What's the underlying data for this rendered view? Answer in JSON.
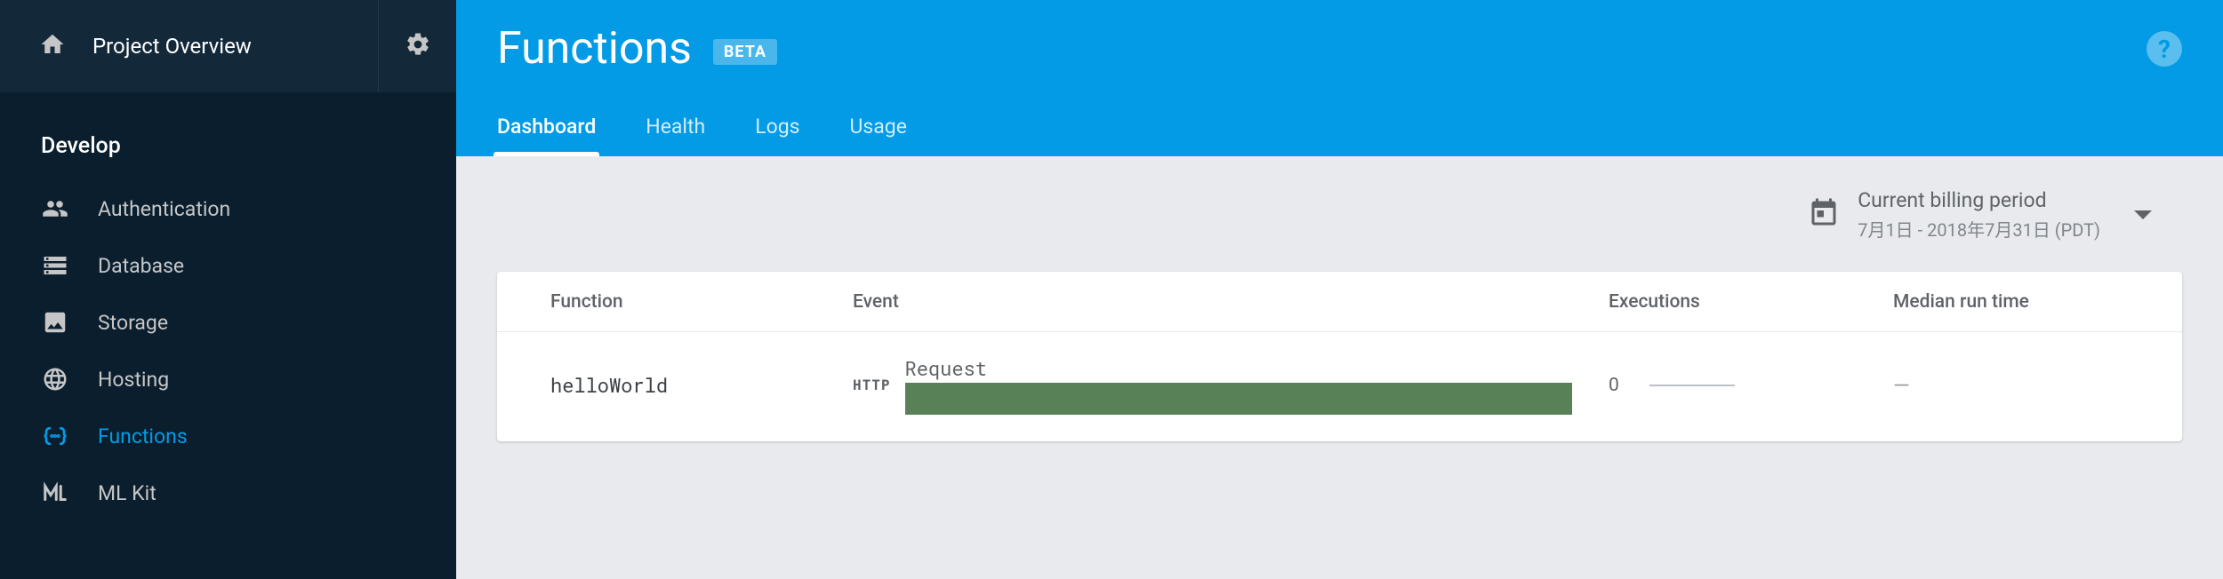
{
  "sidebar": {
    "overview_label": "Project Overview",
    "section_label": "Develop",
    "items": [
      {
        "label": "Authentication",
        "icon": "people"
      },
      {
        "label": "Database",
        "icon": "database"
      },
      {
        "label": "Storage",
        "icon": "storage"
      },
      {
        "label": "Hosting",
        "icon": "globe"
      },
      {
        "label": "Functions",
        "icon": "brackets",
        "active": true
      },
      {
        "label": "ML Kit",
        "icon": "ml"
      }
    ]
  },
  "header": {
    "title": "Functions",
    "badge": "BETA",
    "help_glyph": "?"
  },
  "tabs": [
    {
      "label": "Dashboard",
      "active": true
    },
    {
      "label": "Health"
    },
    {
      "label": "Logs"
    },
    {
      "label": "Usage"
    }
  ],
  "period": {
    "label": "Current billing period",
    "range": "7月1日 - 2018年7月31日 (PDT)"
  },
  "table": {
    "headers": {
      "function": "Function",
      "event": "Event",
      "executions": "Executions",
      "median": "Median run time"
    },
    "row": {
      "function_name": "helloWorld",
      "event_tag": "HTTP",
      "event_label": "Request",
      "executions": "0",
      "median": "—"
    }
  }
}
